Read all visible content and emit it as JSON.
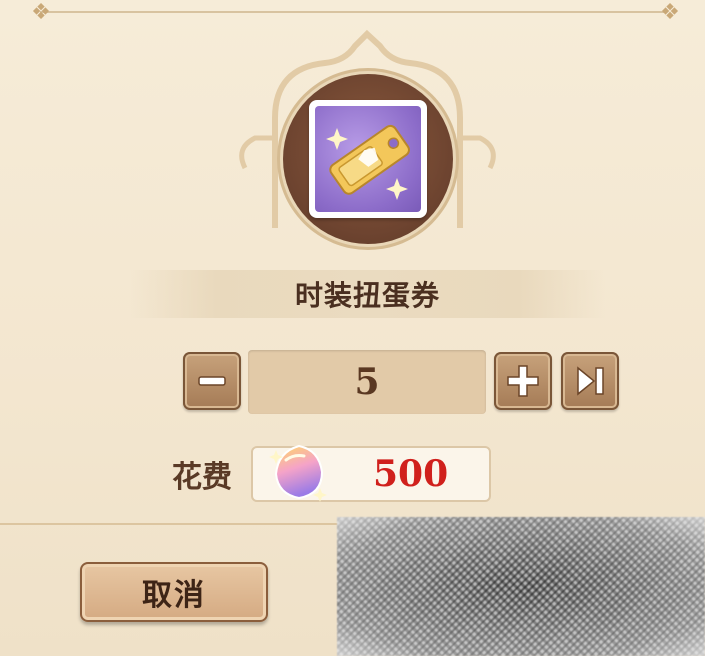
{
  "item": {
    "name": "时装扭蛋券",
    "icon": "costume-gacha-ticket-icon"
  },
  "quantity": {
    "value": "5",
    "minus_icon": "minus-icon",
    "plus_icon": "plus-icon",
    "max_icon": "skip-to-max-icon"
  },
  "cost": {
    "label": "花费",
    "currency_icon": "gem-currency-icon",
    "value": "500",
    "value_color": "#d0201c"
  },
  "actions": {
    "cancel_label": "取消"
  },
  "colors": {
    "panel_bg": "#f6ecd8",
    "text_brown": "#4a2f20",
    "button_brown": "#a47a55",
    "item_purple": "#8c6cc9"
  }
}
